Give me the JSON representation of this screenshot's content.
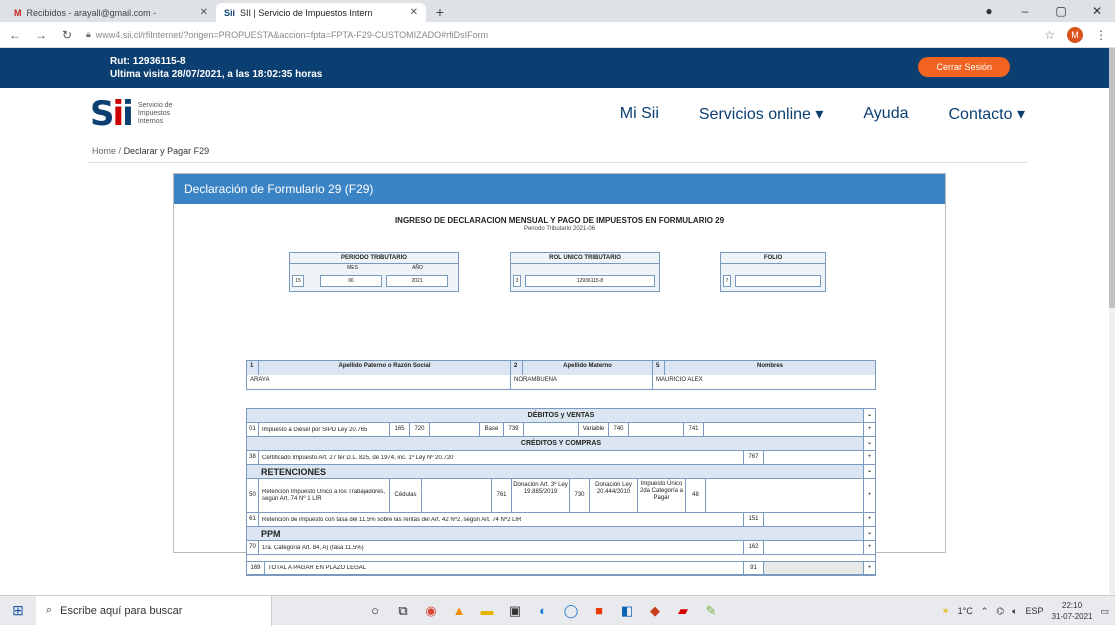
{
  "browser": {
    "tabs": [
      {
        "title": "Recibidos - arayall@gmail.com -",
        "icon": "gmail-icon"
      },
      {
        "title": "SII | Servicio de Impuestos Intern",
        "icon": "sii-favicon-icon"
      }
    ],
    "url": "www4.sii.cl/rfiInternet/?origen=PROPUESTA&accion=fpta=FPTA-F29-CUSTOMIZADO#rfiDsIForm",
    "profile_initial": "M"
  },
  "header": {
    "rut_line": "Rut: 12936115-8",
    "last_visit": "Ultima visita 28/07/2021, a las 18:02:35 horas",
    "logout_label": "Cerrar Sesión"
  },
  "nav": {
    "logo_text": [
      "Servicio de",
      "Impuestos",
      "Internos"
    ],
    "items": [
      "Mi Sii",
      "Servicios online ▾",
      "Ayuda",
      "Contacto ▾"
    ]
  },
  "breadcrumb": {
    "home": "Home",
    "sep": "/",
    "current": "Declarar y Pagar F29"
  },
  "form": {
    "panel_title": "Declaración de Formulario 29 (F29)",
    "title": "INGRESO DE DECLARACION MENSUAL Y PAGO DE IMPUESTOS EN FORMULARIO 29",
    "subtitle": "Periodo Tributario 2021-06",
    "periodo": {
      "header": "PERIODO TRIBUTARIO",
      "mes_label": "MES",
      "ano_label": "AÑO",
      "code": "15",
      "mes": "06",
      "ano": "2021"
    },
    "rut": {
      "header": "ROL UNICO TRIBUTARIO",
      "code": "3",
      "value": "12936115-8"
    },
    "folio": {
      "header": "FOLIO",
      "code": "7"
    },
    "names": {
      "code1": "1",
      "label1": "Apellido Paterno o Razón Social",
      "code2": "2",
      "label2": "Apellido Materno",
      "code3": "5",
      "label3": "Nombres",
      "val1": "ARAYA",
      "val2": "NORAMBUENA",
      "val3": "MAURICIO ALEX"
    },
    "sections": {
      "debitos": "DÉBITOS y VENTAS",
      "debitos_line": {
        "code": "01",
        "text": "Impuesto a Diésel por SIPD Ley 20.765",
        "c1": "165",
        "c2": "720",
        "base": "Base",
        "c3": "739",
        "variable": "Variable",
        "c4": "740",
        "c5": "741"
      },
      "creditos": "CRÉDITOS Y COMPRAS",
      "creditos_line": {
        "code": "38",
        "text": "Certificado Impuesto Art. 27 ter D.L. 825, de 1974, inc. 1º Ley Nº 20.720",
        "c1": "767"
      },
      "retenciones": "RETENCIONES",
      "ret_line1": {
        "code": "50",
        "text": "Retención Impuesto Único a los Trabajadores, según Art. 74 Nº 1 LIR",
        "c1": "Cédulas",
        "c2": "761",
        "d1": "Donación Art. 3º Ley 19.885/2019",
        "c3": "730",
        "d2": "Donación Ley 20.444/2010",
        "d3": "Impuesto Único 2da Categoría a Pagar",
        "c4": "48"
      },
      "ret_line2": {
        "code": "61",
        "text": "Retención de impuesto con tasa del 11,5% sobre las rentas del Art. 42 Nº2, según Art. 74 Nº2 LIR",
        "c1": "151"
      },
      "ppm": "PPM",
      "ppm_line": {
        "code": "70",
        "text": "1ra. Categoría Art. 84, A) (tasa 11,5%)",
        "c1": "162"
      },
      "total_line": {
        "code": "169",
        "text": "TOTAL A PAGAR EN PLAZO LEGAL",
        "c1": "91"
      }
    }
  },
  "taskbar": {
    "search_placeholder": "Escribe aquí para buscar",
    "tray_temp": "1°C",
    "tray_lang": "ESP",
    "time": "22:10",
    "date": "31-07-2021"
  }
}
